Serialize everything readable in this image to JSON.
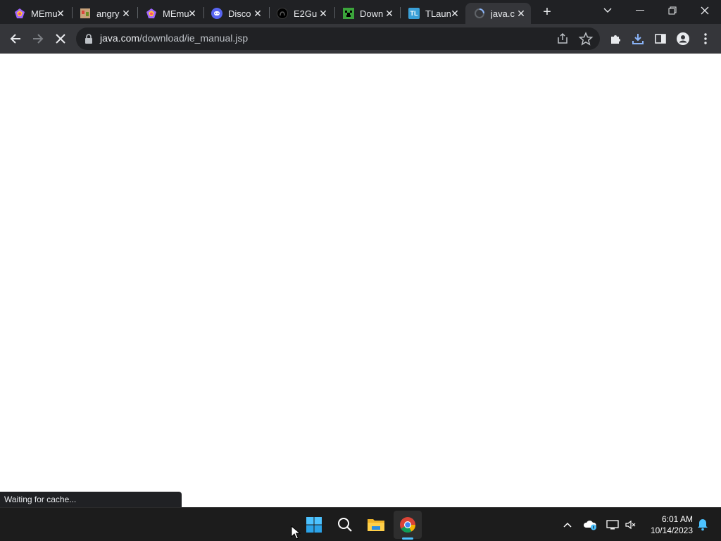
{
  "tabs": [
    {
      "title": "MEmu",
      "favicon": "memu-icon"
    },
    {
      "title": "angry",
      "favicon": "angry-image-icon"
    },
    {
      "title": "MEmu",
      "favicon": "memu-icon"
    },
    {
      "title": "Disco",
      "favicon": "discord-icon"
    },
    {
      "title": "E2Gu",
      "favicon": "github-icon"
    },
    {
      "title": "Down",
      "favicon": "minecraft-icon"
    },
    {
      "title": "TLaun",
      "favicon": "tlauncher-icon"
    },
    {
      "title": "java.c",
      "favicon": "java-loading-icon",
      "active": true
    }
  ],
  "tab_icons": {
    "tl": "TL"
  },
  "address": {
    "host": "java.com",
    "path": "/download/ie_manual.jsp"
  },
  "status_bar": {
    "text": "Waiting for cache..."
  },
  "taskbar": {
    "time": "6:01 AM",
    "date": "10/14/2023"
  },
  "colors": {
    "tab_strip": "#202124",
    "toolbar": "#35363a",
    "taskbar": "#1c1c1c",
    "accent": "#4cc2ff"
  }
}
